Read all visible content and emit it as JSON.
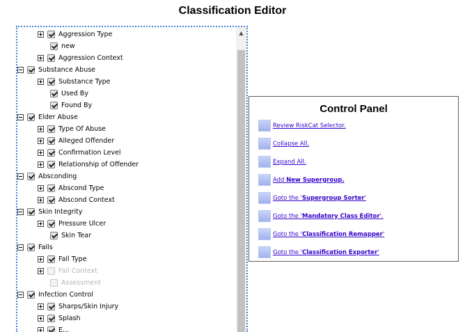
{
  "page": {
    "title": "Classification Editor"
  },
  "tree": {
    "rows": [
      {
        "label": "Aggression Type",
        "level": 2,
        "expander": "plus",
        "checked": true,
        "dim": false
      },
      {
        "label": "new",
        "level": 3,
        "expander": "none",
        "checked": true,
        "dim": false
      },
      {
        "label": "Aggression Context",
        "level": 2,
        "expander": "plus",
        "checked": true,
        "dim": false
      },
      {
        "label": "Substance Abuse",
        "level": 1,
        "expander": "minus",
        "checked": true,
        "dim": false
      },
      {
        "label": "Substance Type",
        "level": 2,
        "expander": "plus",
        "checked": true,
        "dim": false
      },
      {
        "label": "Used By",
        "level": 3,
        "expander": "none",
        "checked": true,
        "dim": false
      },
      {
        "label": "Found By",
        "level": 3,
        "expander": "none",
        "checked": true,
        "dim": false
      },
      {
        "label": "Elder Abuse",
        "level": 1,
        "expander": "minus",
        "checked": true,
        "dim": false
      },
      {
        "label": "Type Of Abuse",
        "level": 2,
        "expander": "plus",
        "checked": true,
        "dim": false
      },
      {
        "label": "Alleged Offender",
        "level": 2,
        "expander": "plus",
        "checked": true,
        "dim": false
      },
      {
        "label": "Confirmation Level",
        "level": 2,
        "expander": "plus",
        "checked": true,
        "dim": false
      },
      {
        "label": "Relationship of Offender",
        "level": 2,
        "expander": "plus",
        "checked": true,
        "dim": false
      },
      {
        "label": "Absconding",
        "level": 1,
        "expander": "minus",
        "checked": true,
        "dim": false
      },
      {
        "label": "Abscond Type",
        "level": 2,
        "expander": "plus",
        "checked": true,
        "dim": false
      },
      {
        "label": "Abscond Context",
        "level": 2,
        "expander": "plus",
        "checked": true,
        "dim": false
      },
      {
        "label": "Skin Integrity",
        "level": 1,
        "expander": "minus",
        "checked": true,
        "dim": false
      },
      {
        "label": "Pressure Ulcer",
        "level": 2,
        "expander": "plus",
        "checked": true,
        "dim": false
      },
      {
        "label": "Skin Tear",
        "level": 3,
        "expander": "none",
        "checked": true,
        "dim": false
      },
      {
        "label": "Falls",
        "level": 1,
        "expander": "minus",
        "checked": true,
        "dim": false
      },
      {
        "label": "Fall Type",
        "level": 2,
        "expander": "plus",
        "checked": true,
        "dim": false
      },
      {
        "label": "Fall Context",
        "level": 2,
        "expander": "plus",
        "checked": false,
        "dim": true
      },
      {
        "label": "Assessment",
        "level": 3,
        "expander": "none",
        "checked": false,
        "dim": true
      },
      {
        "label": "Infection Control",
        "level": 1,
        "expander": "minus",
        "checked": true,
        "dim": false
      },
      {
        "label": "Sharps/Skin Injury",
        "level": 2,
        "expander": "plus",
        "checked": true,
        "dim": false
      },
      {
        "label": "Splash",
        "level": 2,
        "expander": "plus",
        "checked": true,
        "dim": false
      },
      {
        "label": "E...",
        "level": 2,
        "expander": "plus",
        "checked": true,
        "dim": false
      }
    ]
  },
  "control_panel": {
    "title": "Control Panel",
    "links": [
      {
        "prefix": "Review RiskCat Selector.",
        "bold": "",
        "suffix": ""
      },
      {
        "prefix": "Collapse All.",
        "bold": "",
        "suffix": ""
      },
      {
        "prefix": "Expand All.",
        "bold": "",
        "suffix": ""
      },
      {
        "prefix": "Add ",
        "bold": "New Supergroup.",
        "suffix": ""
      },
      {
        "prefix": "Goto the '",
        "bold": "Supergroup Sorter",
        "suffix": "'"
      },
      {
        "prefix": "Goto the '",
        "bold": "Mandatory Class Editor",
        "suffix": "'."
      },
      {
        "prefix": "Goto the '",
        "bold": "Classification Remapper",
        "suffix": "'"
      },
      {
        "prefix": "Goto the '",
        "bold": "Classification Exporter",
        "suffix": "'"
      }
    ]
  }
}
